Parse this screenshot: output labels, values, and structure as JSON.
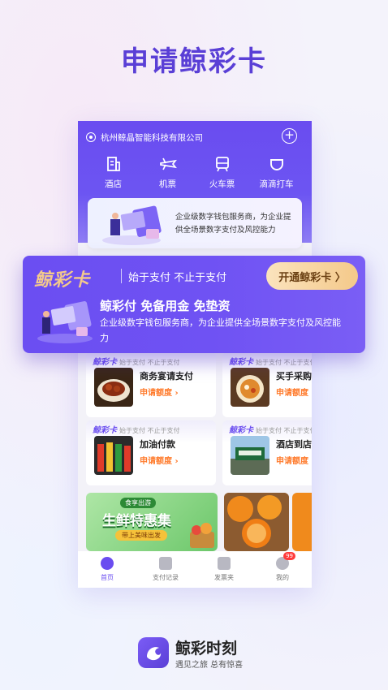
{
  "headline": "申请鲸彩卡",
  "app": {
    "company": "杭州鲸晶智能科技有限公司",
    "services": [
      {
        "label": "酒店",
        "icon": "hotel-icon"
      },
      {
        "label": "机票",
        "icon": "plane-icon"
      },
      {
        "label": "火车票",
        "icon": "train-icon"
      },
      {
        "label": "滴滴打车",
        "icon": "didi-icon"
      }
    ],
    "promo_text": "企业级数字钱包服务商，为企业提供全场景数字支付及风控能力",
    "cards": [
      {
        "tag_brand": "鲸彩卡",
        "tag_slogan": "始于支付 不止于支付",
        "title": "商务宴请支付",
        "cta": "申请额度 ›"
      },
      {
        "tag_brand": "鲸彩卡",
        "tag_slogan": "始于支付 不止于支付",
        "title": "买手采购",
        "cta": "申请额度 ›"
      },
      {
        "tag_brand": "鲸彩卡",
        "tag_slogan": "始于支付 不止于支付",
        "title": "加油付款",
        "cta": "申请额度 ›"
      },
      {
        "tag_brand": "鲸彩卡",
        "tag_slogan": "始于支付 不止于支付",
        "title": "酒店到店付",
        "cta": "申请额度 ›"
      }
    ],
    "banner": {
      "top": "食享出游",
      "main": "生鲜特惠集",
      "sub": "带上美味出发"
    },
    "tabs": [
      {
        "label": "首页",
        "active": true
      },
      {
        "label": "支付记录",
        "active": false
      },
      {
        "label": "发票夹",
        "active": false
      },
      {
        "label": "我的",
        "active": false,
        "badge": "99"
      }
    ]
  },
  "float_card": {
    "brand": "鲸彩卡",
    "slogan": "始于支付 不止于支付",
    "cta": "开通鲸彩卡 〉",
    "title": "鲸彩付 免备用金 免垫资",
    "desc": "企业级数字钱包服务商，为企业提供全场景数字支付及风控能力"
  },
  "footer": {
    "app_name": "鲸彩时刻",
    "slogan": "遇见之旅 总有惊喜"
  },
  "colors": {
    "brand": "#6a4cf0",
    "accent": "#ff7a2b",
    "gold": "#f3c98c"
  }
}
